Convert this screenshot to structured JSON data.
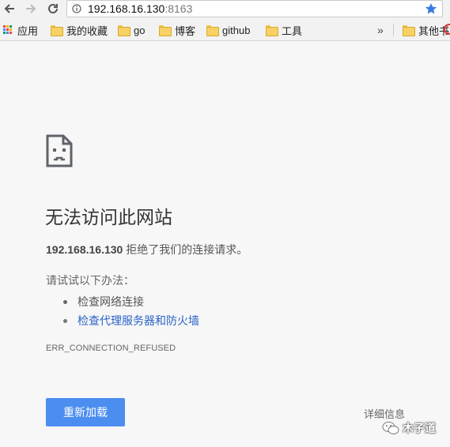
{
  "toolbar": {
    "url_host": "192.168.16.130",
    "url_port": ":8163"
  },
  "bookmarks": {
    "items": [
      {
        "label": "应用",
        "icon": "apps-grid-icon"
      },
      {
        "label": "我的收藏",
        "icon": "folder-icon"
      },
      {
        "label": "go",
        "icon": "folder-icon"
      },
      {
        "label": "博客",
        "icon": "folder-icon"
      },
      {
        "label": "github",
        "icon": "folder-icon"
      },
      {
        "label": "工具",
        "icon": "folder-icon"
      }
    ],
    "overflow": "»",
    "other": "其他书"
  },
  "error": {
    "title": "无法访问此网站",
    "host": "192.168.16.130",
    "message": " 拒绝了我们的连接请求。",
    "suggestions_label": "请试试以下办法：",
    "suggestions": [
      "检查网络连接",
      "检查代理服务器和防火墙"
    ],
    "code": "ERR_CONNECTION_REFUSED",
    "reload_label": "重新加载",
    "details_label": "详细信息"
  },
  "watermark": {
    "text": "木子道"
  },
  "colors": {
    "accent": "#4b8ef0",
    "link": "#2b63c7",
    "star": "#3a7be0"
  }
}
